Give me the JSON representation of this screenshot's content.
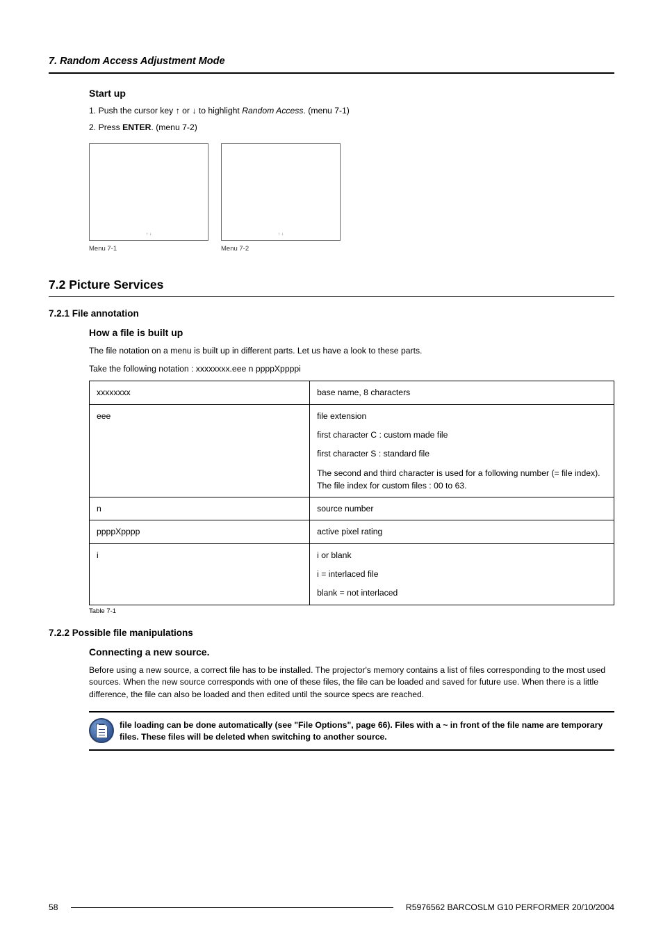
{
  "chapter": "7. Random Access Adjustment Mode",
  "startup": {
    "heading": "Start up",
    "steps": [
      {
        "no": "1.",
        "text_pre": "Push the cursor key ↑ or ↓ to highlight ",
        "text_em": "Random Access",
        "text_post": ". (menu 7-1)"
      },
      {
        "no": "2.",
        "text_pre": "Press ",
        "text_bold": "ENTER",
        "text_post": ". (menu 7-2)"
      }
    ],
    "menus": [
      {
        "hint": "↑      ↓",
        "caption": "Menu 7-1"
      },
      {
        "hint": "↑      ↓",
        "caption": "Menu 7-2"
      }
    ]
  },
  "section72": {
    "heading": "7.2   Picture Services",
    "sub1": {
      "heading": "7.2.1    File annotation",
      "subhead": "How a file is built up",
      "p1": "The file notation on a menu is built up in different parts. Let us have a look to these parts.",
      "p2": "Take the following notation : xxxxxxxx.eee n ppppXppppi",
      "table": {
        "rows": [
          {
            "k": "xxxxxxxx",
            "v": [
              "base name, 8 characters"
            ]
          },
          {
            "k": "eee",
            "v": [
              "file extension",
              "first character C : custom made file",
              "first character S : standard file",
              "The second and third character is used for a following number (= file index). The file index for custom files : 00 to 63."
            ]
          },
          {
            "k": "n",
            "v": [
              "source number"
            ]
          },
          {
            "k": "ppppXpppp",
            "v": [
              "active pixel rating"
            ]
          },
          {
            "k": "i",
            "v": [
              "i or blank",
              "i = interlaced file",
              "blank = not interlaced"
            ]
          }
        ],
        "caption": "Table 7-1"
      }
    },
    "sub2": {
      "heading": "7.2.2    Possible file manipulations",
      "subhead": "Connecting a new source.",
      "p1": "Before using a new source, a correct file has to be installed. The projector's memory contains a list of files corresponding to the most used sources. When the new source corresponds with one of these files, the file can be loaded and saved for future use. When there is a little difference, the file can also be loaded and then edited until the source specs are reached.",
      "note": "file loading can be done automatically (see \"File Options\", page 66). Files with a ~ in front of the file name are temporary files. These files will be deleted when switching to another source."
    }
  },
  "footer": {
    "page": "58",
    "docid": "R5976562  BARCOSLM G10 PERFORMER  20/10/2004"
  }
}
